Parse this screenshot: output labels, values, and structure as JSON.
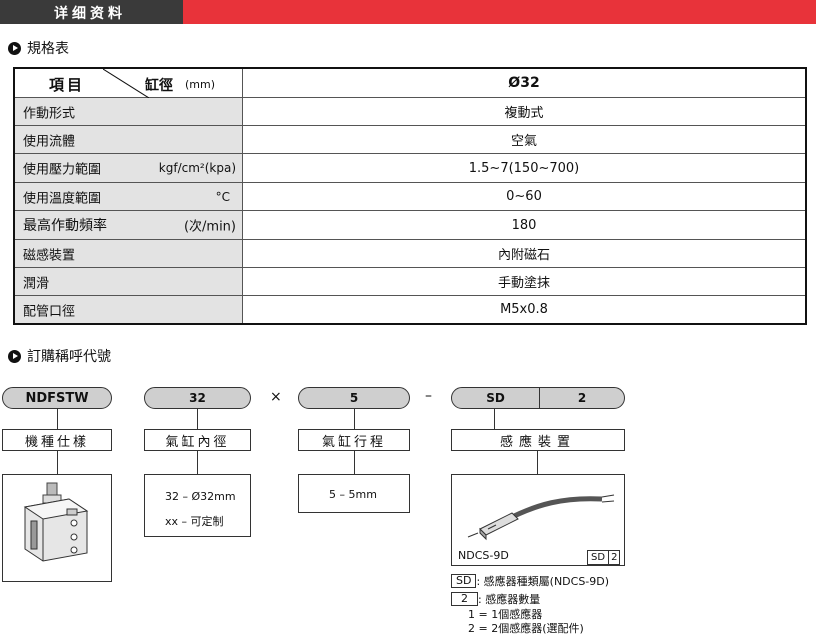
{
  "header": {
    "title": "详细资料"
  },
  "spec_section": {
    "title": "規格表"
  },
  "spec_table": {
    "head_item": "項目",
    "head_bore": "缸徑",
    "head_unit": "(mm)",
    "head_value": "Ø32",
    "rows": [
      {
        "label": "作動形式",
        "unit": "",
        "value": "複動式"
      },
      {
        "label": "使用流體",
        "unit": "",
        "value": "空氣"
      },
      {
        "label": "使用壓力範圍",
        "unit": "kgf/cm²(kpa)",
        "value": "1.5~7(150~700)"
      },
      {
        "label": "使用溫度範圍",
        "unit": "°C",
        "value": "0~60"
      },
      {
        "label": "最高作動頻率",
        "unit": "(次/min)",
        "value": "180"
      },
      {
        "label": "磁感裝置",
        "unit": "",
        "value": "內附磁石"
      },
      {
        "label": "潤滑",
        "unit": "",
        "value": "手動塗抹"
      },
      {
        "label": "配管口徑",
        "unit": "",
        "value": "M5x0.8"
      }
    ]
  },
  "order_section": {
    "title": "訂購稱呼代號"
  },
  "order_code": {
    "model": "NDFSTW",
    "bore": "32",
    "times": "×",
    "stroke": "5",
    "dash": "–",
    "sensor": "SD",
    "sensor_qty": "2",
    "label_model": "機種仕樣",
    "label_bore": "氣缸內徑",
    "label_stroke": "氣缸行程",
    "label_sensor": "感應裝置",
    "bore_opt1": "32 – Ø32mm",
    "bore_opt2": "xx – 可定制",
    "stroke_opt1": "5 – 5mm",
    "sensor_model": "NDCS-9D",
    "sensor_tag_sd": "SD",
    "sensor_tag_2": "2",
    "note_sd_key": "SD",
    "note_sd_text": ": 感應器種類屬(NDCS-9D)",
    "note_qty_key": "2",
    "note_qty_text": ": 感應器數量",
    "note_qty_1": "1 = 1個感應器",
    "note_qty_2": "2 = 2個感應器(選配件)"
  },
  "icons": [
    "play-bullet-icon",
    "cylinder-image",
    "sensor-image"
  ]
}
